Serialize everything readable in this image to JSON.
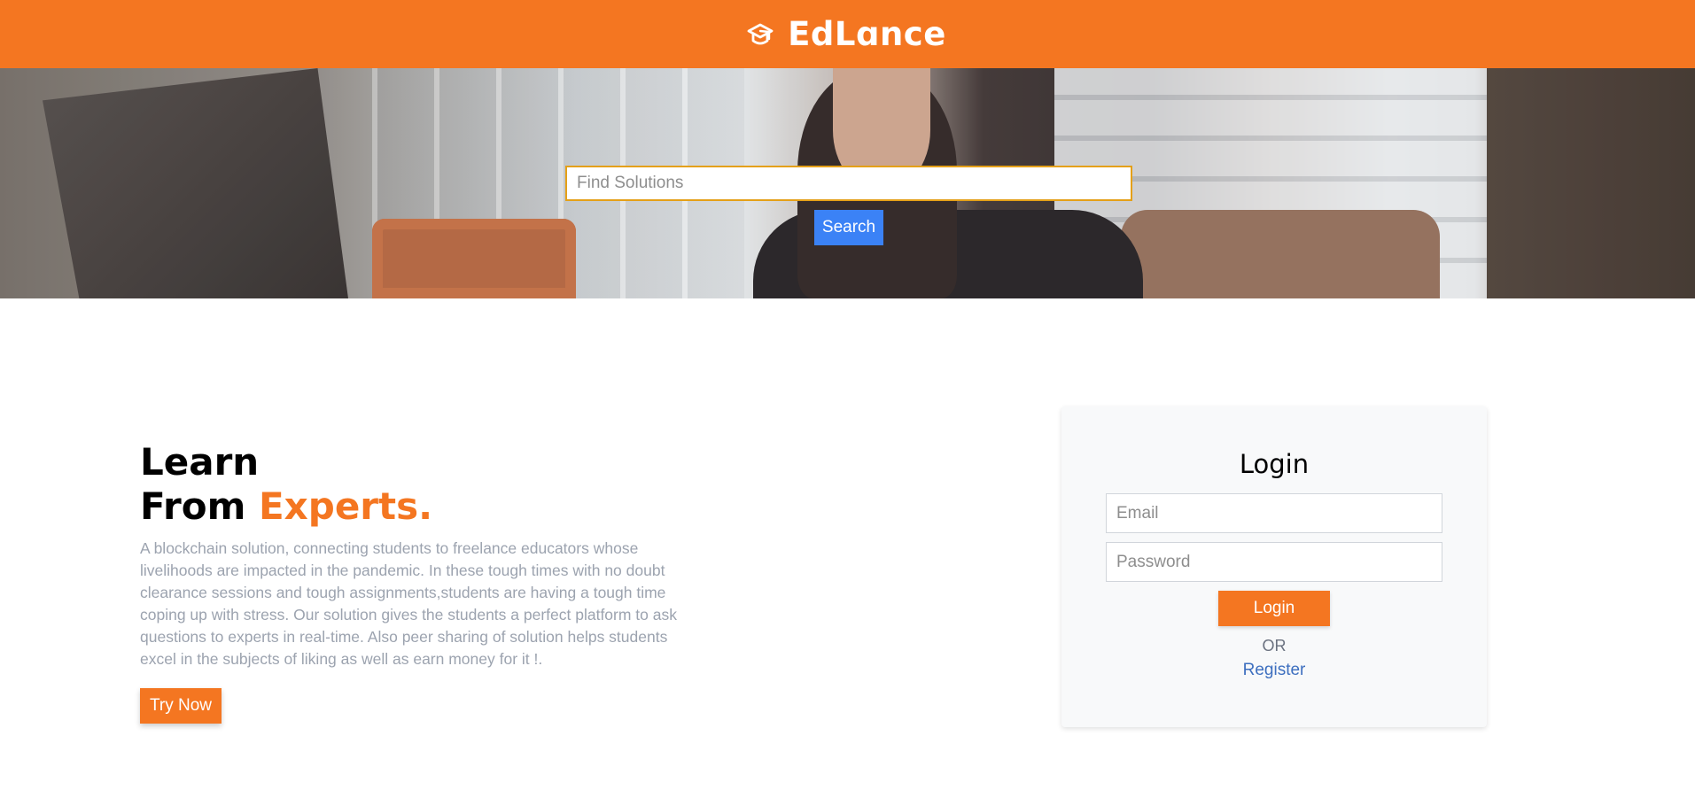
{
  "header": {
    "brand_name": "EdLɑnce",
    "logo_icon": "graduation-cap-icon",
    "background_color": "#f47621"
  },
  "hero": {
    "search_placeholder": "Find Solutions",
    "search_value": "",
    "search_button_label": "Search",
    "search_button_color": "#3b82f6"
  },
  "intro": {
    "headline_line1": "Learn",
    "headline_line2_prefix": "From ",
    "headline_line2_accent": "Experts.",
    "accent_color": "#f47621",
    "description": "A blockchain solution, connecting students to freelance educators whose livelihoods are impacted in the pandemic. In these tough times with no doubt clearance sessions and tough assignments,students are having a tough time coping up with stress. Our solution gives the students a perfect platform to ask questions to experts in real-time. Also peer sharing of solution helps students excel in the subjects of liking as well as earn money for it !.",
    "cta_label": "Try Now"
  },
  "login": {
    "title": "Login",
    "email_placeholder": "Email",
    "password_placeholder": "Password",
    "submit_label": "Login",
    "or_text": "OR",
    "register_label": "Register"
  }
}
